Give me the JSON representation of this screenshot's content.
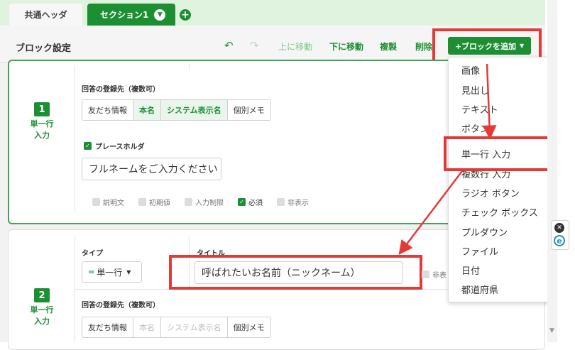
{
  "tabs": {
    "common": "共通ヘッダ",
    "section": "セクション1"
  },
  "header": {
    "title": "ブロック設定",
    "move_up": "上に移動",
    "move_down": "下に移動",
    "duplicate": "複製",
    "delete": "削除",
    "add_block": "+ブロックを追加"
  },
  "block1": {
    "number": "1",
    "type_line1": "単一行",
    "type_line2": "入力",
    "destination_label": "回答の登録先（複数可）",
    "destinations": [
      "友だち情報",
      "本名",
      "システム表示名",
      "個別メモ"
    ],
    "placeholder_label": "プレースホルダ",
    "placeholder_value": "フルネームをご入力ください",
    "options": [
      "説明文",
      "初期値",
      "入力制限",
      "必須",
      "非表示"
    ]
  },
  "block2": {
    "number": "2",
    "type_line1": "単一行",
    "type_line2": "入力",
    "type_label": "タイプ",
    "type_value": "単一行",
    "title_label": "タイトル",
    "title_value": "呼ばれたいお名前（ニックネーム）",
    "hidden_partial": "非表",
    "destination_label": "回答の登録先（複数可）",
    "destinations": [
      "友だち情報",
      "本名",
      "システム表示名",
      "個別メモ"
    ]
  },
  "menu": [
    "画像",
    "見出し",
    "テキスト",
    "ボタン",
    "単一行 入力",
    "複数行 入力",
    "ラジオ ボタン",
    "チェック ボックス",
    "プルダウン",
    "ファイル",
    "日付",
    "都道府県"
  ],
  "colors": {
    "brand": "#1d8f33",
    "highlight": "#e53935"
  }
}
